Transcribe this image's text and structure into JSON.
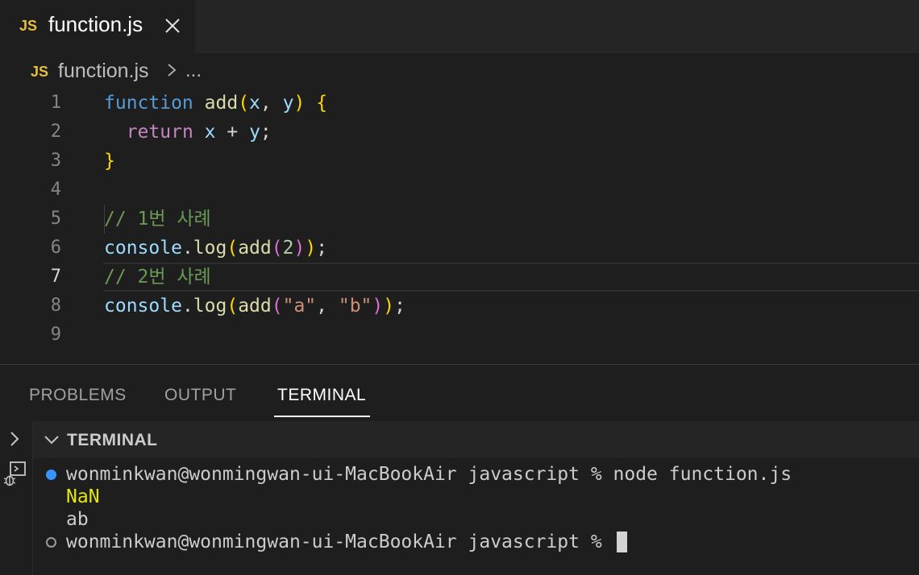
{
  "tab": {
    "badge": "JS",
    "title": "function.js",
    "close": "✕"
  },
  "breadcrumb": {
    "badge": "JS",
    "file": "function.js",
    "separator": "›",
    "more": "..."
  },
  "editor": {
    "line_numbers": [
      "1",
      "2",
      "3",
      "4",
      "5",
      "6",
      "7",
      "8",
      "9"
    ],
    "current_line": 7,
    "lines": [
      [
        {
          "t": "function",
          "c": "kw"
        },
        {
          "t": " ",
          "c": ""
        },
        {
          "t": "add",
          "c": "fn"
        },
        {
          "t": "(",
          "c": "brace"
        },
        {
          "t": "x",
          "c": "var"
        },
        {
          "t": ", ",
          "c": ""
        },
        {
          "t": "y",
          "c": "var"
        },
        {
          "t": ")",
          "c": "brace"
        },
        {
          "t": " ",
          "c": ""
        },
        {
          "t": "{",
          "c": "brace"
        }
      ],
      [
        {
          "t": "  ",
          "c": ""
        },
        {
          "t": "return",
          "c": "ret"
        },
        {
          "t": " ",
          "c": ""
        },
        {
          "t": "x",
          "c": "var"
        },
        {
          "t": " + ",
          "c": ""
        },
        {
          "t": "y",
          "c": "var"
        },
        {
          "t": ";",
          "c": ""
        }
      ],
      [
        {
          "t": "}",
          "c": "brace"
        }
      ],
      [],
      [
        {
          "t": "// 1번 사례",
          "c": "cmt"
        }
      ],
      [
        {
          "t": "console",
          "c": "var"
        },
        {
          "t": ".",
          "c": ""
        },
        {
          "t": "log",
          "c": "fn"
        },
        {
          "t": "(",
          "c": "brace"
        },
        {
          "t": "add",
          "c": "fn"
        },
        {
          "t": "(",
          "c": "paren2"
        },
        {
          "t": "2",
          "c": "num"
        },
        {
          "t": ")",
          "c": "paren2"
        },
        {
          "t": ")",
          "c": "brace"
        },
        {
          "t": ";",
          "c": ""
        }
      ],
      [
        {
          "t": "// 2번 사례",
          "c": "cmt"
        }
      ],
      [
        {
          "t": "console",
          "c": "var"
        },
        {
          "t": ".",
          "c": ""
        },
        {
          "t": "log",
          "c": "fn"
        },
        {
          "t": "(",
          "c": "brace"
        },
        {
          "t": "add",
          "c": "fn"
        },
        {
          "t": "(",
          "c": "paren2"
        },
        {
          "t": "\"a\"",
          "c": "str"
        },
        {
          "t": ", ",
          "c": ""
        },
        {
          "t": "\"b\"",
          "c": "str"
        },
        {
          "t": ")",
          "c": "paren2"
        },
        {
          "t": ")",
          "c": "brace"
        },
        {
          "t": ";",
          "c": ""
        }
      ],
      []
    ]
  },
  "panel": {
    "tabs": [
      "PROBLEMS",
      "OUTPUT",
      "TERMINAL"
    ],
    "active_tab": "TERMINAL"
  },
  "terminal": {
    "header": "TERMINAL",
    "lines": [
      "wonminkwan@wonmingwan-ui-MacBookAir javascript % node function.js",
      "NaN",
      "ab",
      "wonminkwan@wonmingwan-ui-MacBookAir javascript % "
    ]
  },
  "icons": {
    "tab_close": "close-icon",
    "breadcrumb_sep": "chevron-right-icon",
    "side_expand": "chevron-right-icon",
    "side_debug": "debug-console-icon",
    "term_collapse": "chevron-down-icon"
  }
}
